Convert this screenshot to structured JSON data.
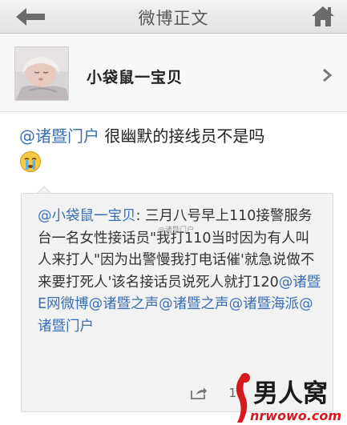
{
  "nav": {
    "title": "微博正文",
    "back_icon": "back-arrow-icon",
    "home_icon": "home-icon"
  },
  "user": {
    "name": "小袋鼠一宝贝",
    "avatar": "baby-avatar"
  },
  "post": {
    "mention": "@诸暨门户",
    "text": " 很幽默的接线员不是吗",
    "emoji": "crying-face-emoji"
  },
  "repost": {
    "author": "@小袋鼠一宝贝",
    "body": ": 三月八号早上110接警服务台一名女性接话员\"我打110当时因为有人叫人来打人\"因为出警慢我打电话催'就急说做不来要打死人'该名接话员说死人就打120",
    "m1": "@诸暨E网微博",
    "m2": "@诸暨之声",
    "m3": "@诸暨之声",
    "m4": "@诸暨海派",
    "m5": "@诸暨门户",
    "watermark": "@诸暨门户",
    "count": "1"
  },
  "logo": {
    "text": "男人窝",
    "domain": "nrwowo.com"
  },
  "colors": {
    "mention": "#3a6fb5",
    "logo_red": "#d7191e"
  }
}
